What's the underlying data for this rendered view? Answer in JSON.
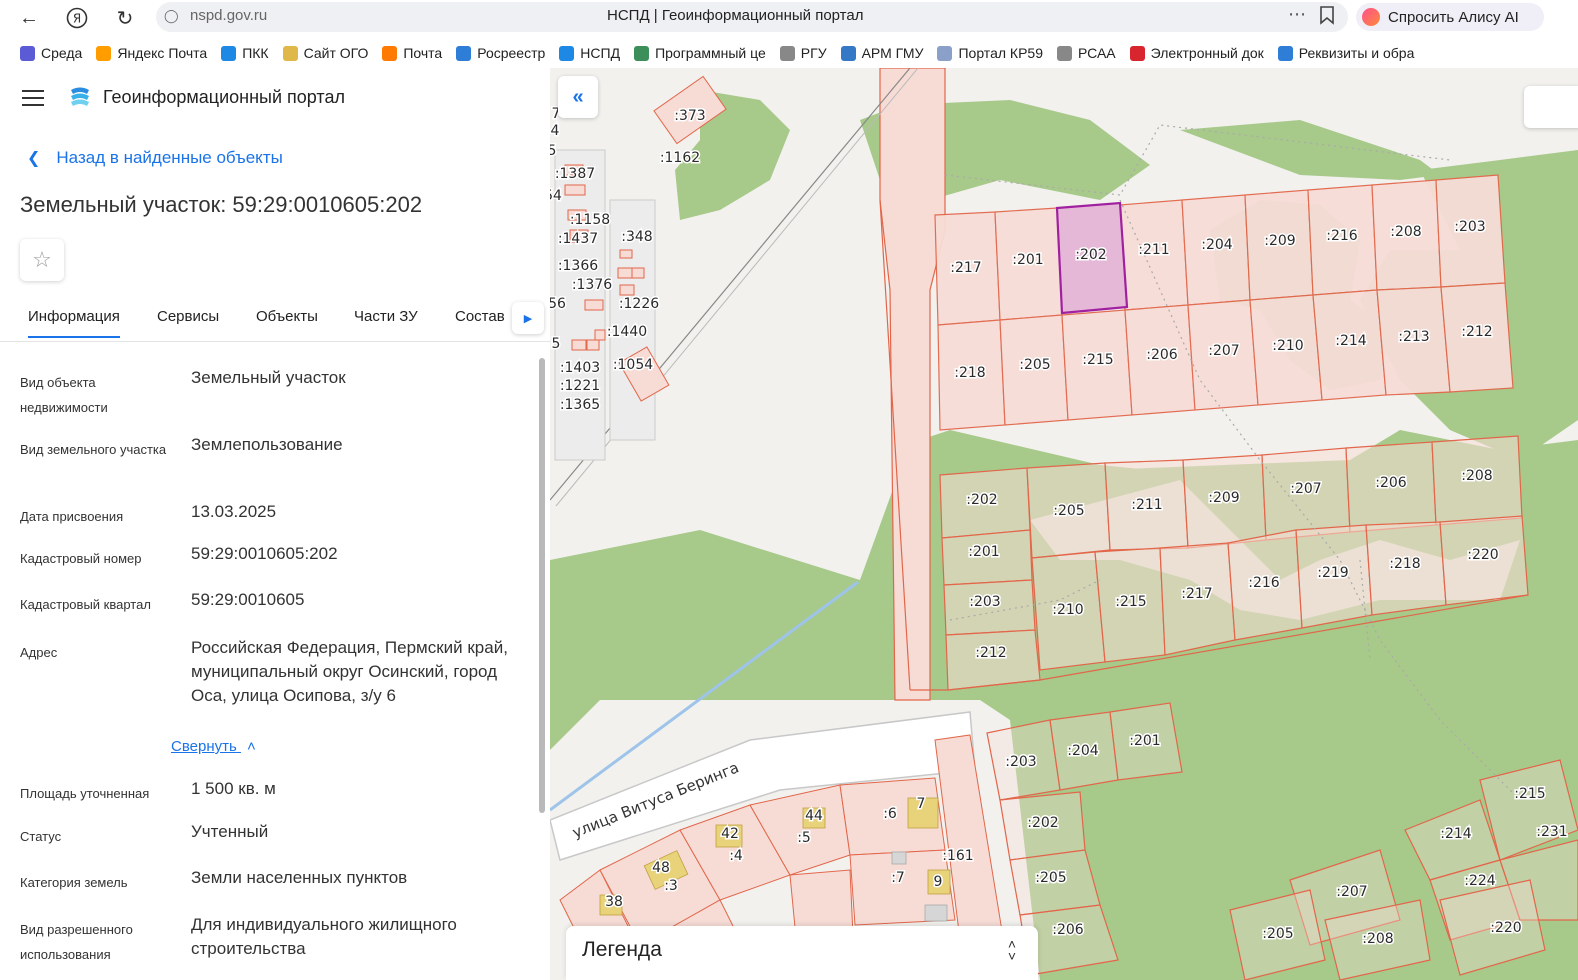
{
  "browser": {
    "url": "nspd.gov.ru",
    "title": "НСПД | Геоинформационный портал",
    "alice_label": "Спросить Алису AI",
    "bookmarks": [
      {
        "label": "Среда",
        "color": "#5b5bd6"
      },
      {
        "label": "Яндекс Почта",
        "color": "#ff9c00"
      },
      {
        "label": "ПКК",
        "color": "#1e88e5"
      },
      {
        "label": "Сайт ОГО",
        "color": "#e0b84a"
      },
      {
        "label": "Почта",
        "color": "#ff7a00"
      },
      {
        "label": "Росреестр",
        "color": "#2e7dd7"
      },
      {
        "label": "НСПД",
        "color": "#1e88e5"
      },
      {
        "label": "Программный це",
        "color": "#3c8f5a"
      },
      {
        "label": "РГУ",
        "color": "#888888"
      },
      {
        "label": "АРМ ГМУ",
        "color": "#3478c6"
      },
      {
        "label": "Портал КР59",
        "color": "#8aa0c8"
      },
      {
        "label": "РСАА",
        "color": "#888888"
      },
      {
        "label": "Электронный док",
        "color": "#d7262d"
      },
      {
        "label": "Реквизиты и обра",
        "color": "#2e7dd7"
      }
    ]
  },
  "panel": {
    "portal_title": "Геоинформационный портал",
    "back_label": "Назад в найденные объекты",
    "parcel_title": "Земельный участок: 59:29:0010605:202",
    "tabs": [
      "Информация",
      "Сервисы",
      "Объекты",
      "Части ЗУ",
      "Состав"
    ],
    "fields": [
      {
        "key": "Вид объекта недвижимости",
        "value": "Земельный участок"
      },
      {
        "key": "Вид земельного участка",
        "value": "Землепользование"
      },
      {
        "key": "Дата присвоения",
        "value": "13.03.2025"
      },
      {
        "key": "Кадастровый номер",
        "value": "59:29:0010605:202"
      },
      {
        "key": "Кадастровый квартал",
        "value": "59:29:0010605"
      },
      {
        "key": "Адрес",
        "value": "Российская Федерация, Пермский край, муниципальный округ Осинский, город Оса, улица Осипова, з/у 6"
      },
      {
        "key": "Площадь уточненная",
        "value": "1 500 кв. м"
      },
      {
        "key": "Статус",
        "value": "Учтенный"
      },
      {
        "key": "Категория земель",
        "value": "Земли населенных пунктов"
      },
      {
        "key": "Вид разрешенного использования",
        "value": "Для индивидуального жилищного строительства"
      }
    ],
    "collapse_label": "Свернуть"
  },
  "map": {
    "street_name": "улица Витуса Беринга",
    "legend_title": "Легенда",
    "colors": {
      "parcel_fill": "#f7dcd6",
      "parcel_stroke": "#e2664a",
      "selected_fill": "#e6b8d8",
      "selected_stroke": "#a020a0",
      "green": "#a7c98a",
      "building": "#e8d27a"
    },
    "labels": [
      ":373",
      ":1162",
      ":1387",
      ":1158",
      ":348",
      ":1437",
      ":1366",
      ":1376",
      ":1226",
      ":1440",
      ":1403",
      ":1054",
      ":1221",
      ":1365",
      ":217",
      ":201",
      ":202",
      ":211",
      ":204",
      ":209",
      ":216",
      ":208",
      ":203",
      ":218",
      ":205",
      ":215",
      ":206",
      ":207",
      ":210",
      ":214",
      ":213",
      ":212",
      ":202",
      ":205",
      ":211",
      ":209",
      ":207",
      ":206",
      ":208",
      ":201",
      ":203",
      ":210",
      ":215",
      ":217",
      ":216",
      ":219",
      ":218",
      ":220",
      ":212",
      ":203",
      ":204",
      ":201",
      ":202",
      ":205",
      ":206",
      ":215",
      ":214",
      ":231",
      ":224",
      ":207",
      ":205",
      ":208",
      ":220",
      "42",
      ":4",
      "44",
      ":5",
      ":6",
      "7",
      ":161",
      "48",
      ":3",
      ":7",
      "9",
      "38",
      "7",
      "4",
      "5",
      "54",
      "56",
      "5"
    ]
  }
}
